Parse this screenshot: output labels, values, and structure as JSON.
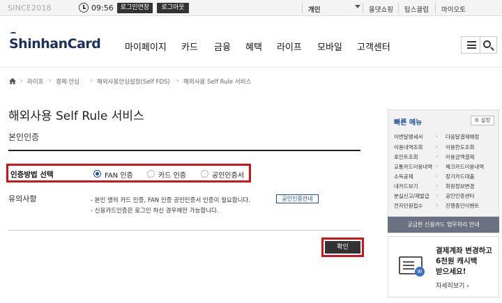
{
  "topbar": {
    "since": "SINCE2018",
    "time": "09:56",
    "extend_label": "로그인연장",
    "logout_label": "로그아웃",
    "links": [
      "개인",
      "올댓쇼핑",
      "탑스클럽",
      "마이오토"
    ]
  },
  "header": {
    "logo": "ShinhanCard",
    "nav": [
      "마이페이지",
      "카드",
      "금융",
      "혜택",
      "라이프",
      "모바일",
      "고객센터"
    ]
  },
  "breadcrumb": [
    "라이프",
    "결제·안심",
    "해외사용안심설정(Self FDS)",
    "해외사용 Self Rule 서비스"
  ],
  "main": {
    "title": "해외사용 Self Rule 서비스",
    "section_title": "본인인증",
    "auth": {
      "label": "인증방법 선택",
      "options": [
        "FAN 인증",
        "카드 인증",
        "공인인증서"
      ],
      "selected_index": 0
    },
    "notice": {
      "title": "유의사항",
      "lines": [
        "- 본인 명의 카드 인증, FAN 인증 공인인증서 인증이 필요합니다.",
        "- 신용카드인증은 로그인 하신 경우에만 가능합니다."
      ],
      "button": "공인인증안내"
    },
    "confirm_label": "확인"
  },
  "quick_menu": {
    "title": "빠른 메뉴",
    "settings_label": "설정",
    "items_left": [
      "이번달명세서",
      "이용내역조회",
      "포인트조회",
      "교통카드이용내역",
      "소득공제",
      "내카드보기",
      "분실신고/재발급",
      "전자민원접수"
    ],
    "items_right": [
      "다음달결제예정",
      "이용한도조회",
      "이용금액결제",
      "체크카드이용내역",
      "장기카드대출",
      "회원정보변경",
      "공인인증센터",
      "진행중인이벤트"
    ],
    "banner": "궁금한 신용카드 업무처리 안내"
  },
  "promo": {
    "lines": [
      "결제계좌 변경하고",
      "6천원 캐시백",
      "받으세요!"
    ],
    "more": "자세히보기 ›",
    "coin": "W"
  }
}
